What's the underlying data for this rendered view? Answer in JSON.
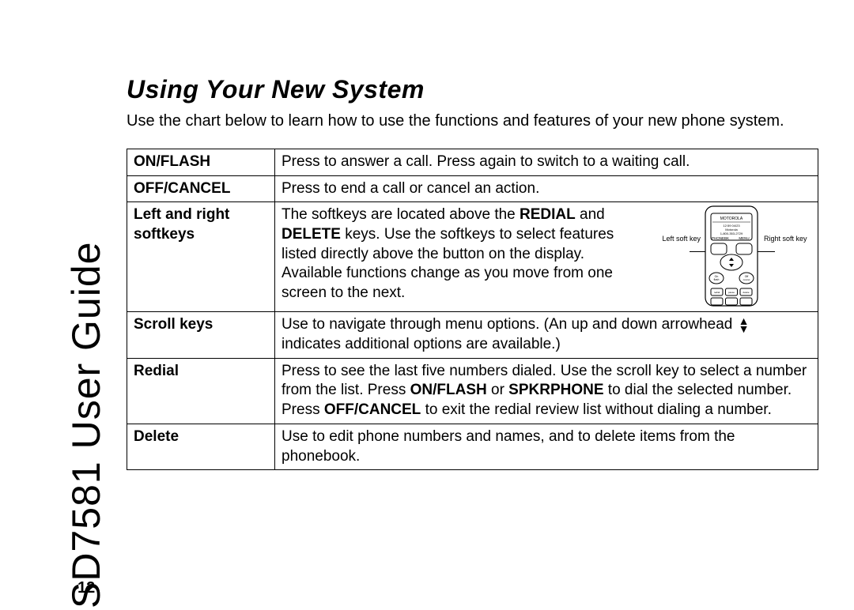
{
  "sideTitle": "SD7581 User Guide",
  "heading": "Using Your New System",
  "intro": "Use the chart below to learn how to use the functions and features of your new phone system.",
  "pageNum": "12",
  "rows": {
    "r0label": "ON/FLASH",
    "r0text": "Press to answer a call. Press again to switch to a waiting call.",
    "r1label": "OFF/CANCEL",
    "r1text": "Press to end a call or cancel an action.",
    "r2label": "Left and right softkeys",
    "r2pre": "The softkeys are located above the ",
    "r2bold": "REDIAL",
    "r2mid": " and ",
    "r2bold2": "DELETE",
    "r2post": " keys. Use the softkeys to select features listed directly above the button on the display. Available functions change as you move from one screen to the next.",
    "r3label": "Scroll keys",
    "r3a": "Use to navigate through menu options. (An up and down arrowhead ",
    "r3b": " indicates additional options are available.)",
    "r4label": "Redial",
    "r4a": "Press to see the last five numbers dialed. Use the scroll key to select a number from the list. Press ",
    "r4b1": "ON/FLASH",
    "r4c": " or ",
    "r4b2": "SPKRPHONE",
    "r4d": " to dial the selected number. Press ",
    "r4b3": "OFF/CANCEL",
    "r4e": " to exit the redial review list without dialing a number.",
    "r5label": "Delete",
    "r5text": "Use to edit phone numbers and names, and to delete items from the phonebook."
  },
  "diagram": {
    "leftLabel": "Left soft key",
    "rightLabel": "Right soft key"
  }
}
